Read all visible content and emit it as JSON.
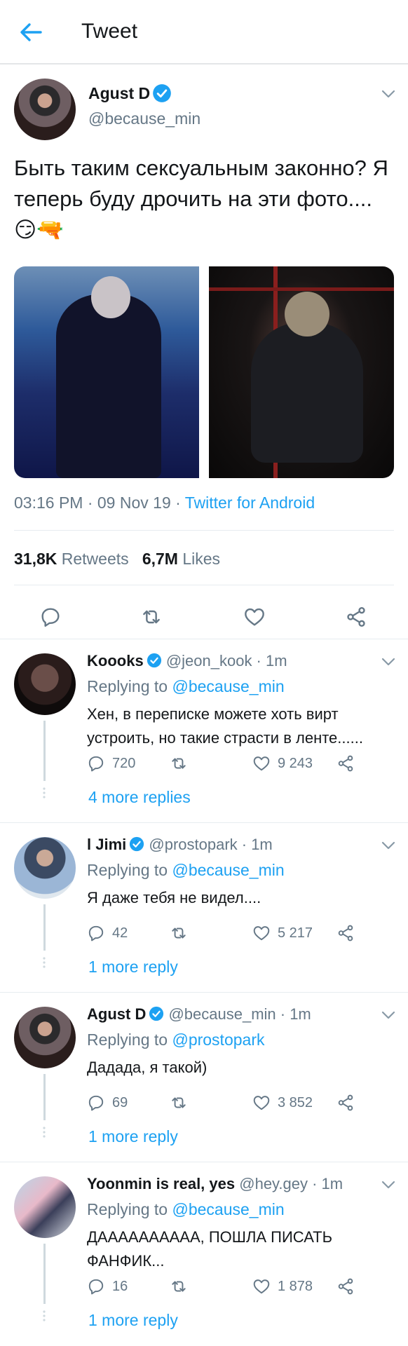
{
  "header": {
    "title": "Tweet"
  },
  "tweet": {
    "name": "Agust D",
    "handle": "@because_min",
    "text": "Быть таким сексуальным законно? Я теперь буду дрочить на эти фото.... 😏🔫",
    "meta_time": "03:16 PM · 09 Nov 19 · ",
    "meta_source": "Twitter for Android",
    "retweets_count": "31,8K",
    "retweets_label": "Retweets",
    "likes_count": "6,7M",
    "likes_label": "Likes"
  },
  "replies": [
    {
      "name": "Koooks",
      "handle_time": "@jeon_kook · 1m",
      "replying_prefix": "Replying to ",
      "replying_to": "@because_min",
      "text": "Хен, в переписке можете хоть вирт устроить, но такие страсти в ленте......",
      "comments": "720",
      "retweets": "",
      "likes": "9 243",
      "more": "4 more replies"
    },
    {
      "name": "l Jimi",
      "handle_time": "@prostopark · 1m",
      "replying_prefix": "Replying to ",
      "replying_to": "@because_min",
      "text": "Я даже тебя не видел....",
      "comments": "42",
      "retweets": "",
      "likes": "5 217",
      "more": "1 more reply"
    },
    {
      "name": "Agust D",
      "handle_time": "@because_min · 1m",
      "replying_prefix": "Replying to ",
      "replying_to": "@prostopark",
      "text": "Дадада, я такой)",
      "comments": "69",
      "retweets": "",
      "likes": "3 852",
      "more": "1 more reply"
    },
    {
      "name": "Yoonmin is real, yes",
      "handle_time": "@hey.gey · 1m",
      "replying_prefix": "Replying to ",
      "replying_to": "@because_min",
      "text": "ДАААААААААА, ПОШЛА ПИСАТЬ ФАНФИК...",
      "comments": "16",
      "retweets": "",
      "likes": "1 878",
      "more": "1 more reply"
    }
  ],
  "colors": {
    "accent": "#1da1f2",
    "muted": "#657786",
    "text": "#14171a"
  }
}
